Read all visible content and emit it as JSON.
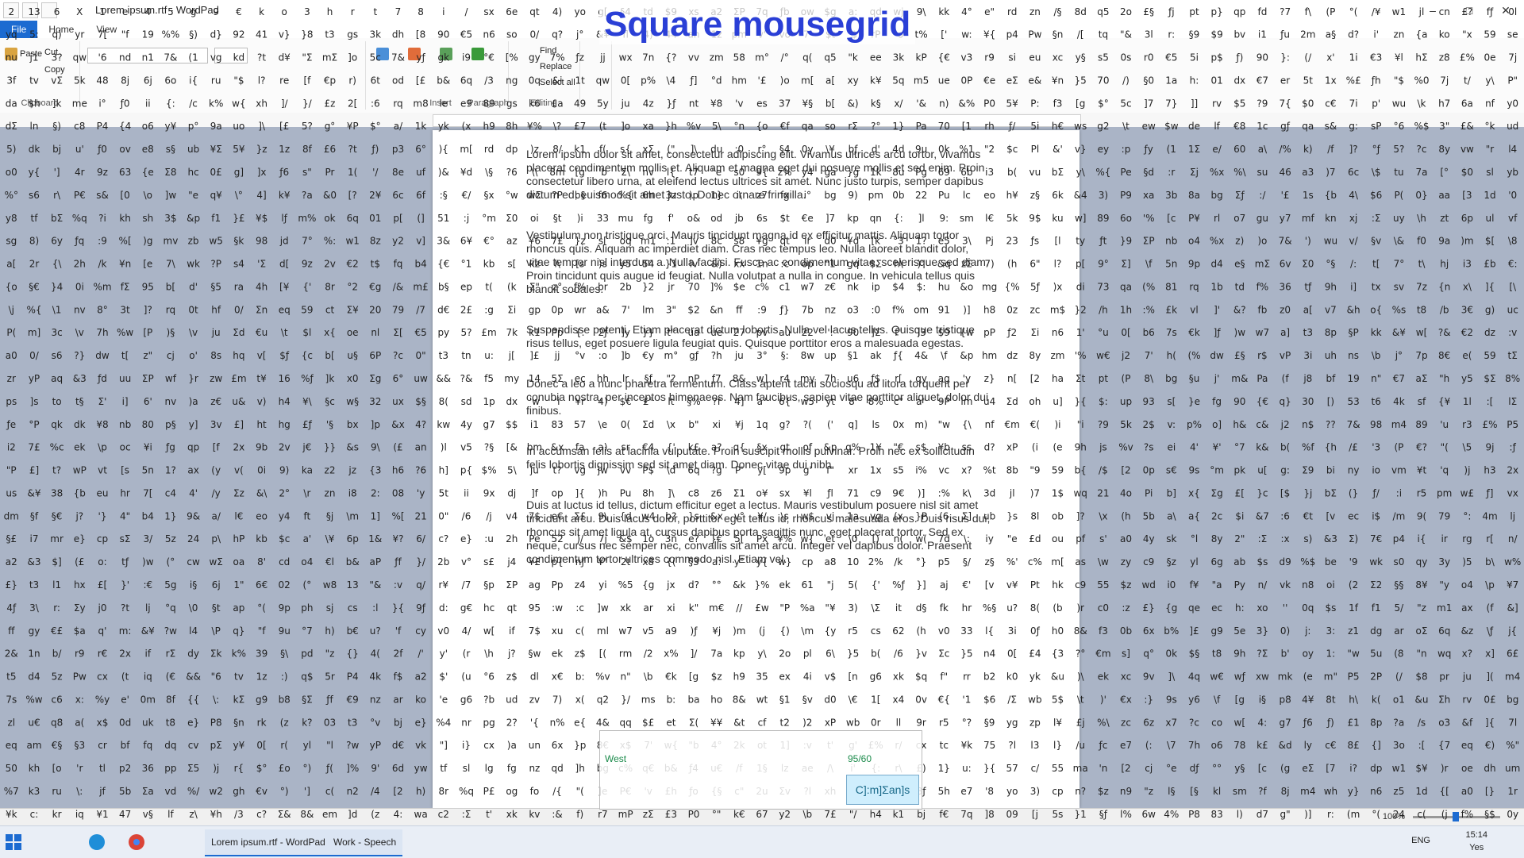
{
  "window": {
    "title": "Lorem ipsum.rtf - WordPad",
    "controls": [
      "–",
      "□",
      "✕"
    ]
  },
  "ribbon": {
    "tabs": [
      "File",
      "Home",
      "View"
    ],
    "clipboard": {
      "label": "Clipboard",
      "cut": "Cut",
      "copy": "Copy",
      "paste": "Paste"
    },
    "paragraph": {
      "label": "Paragraph"
    },
    "insert": {
      "label": "Insert",
      "picture": "Picture",
      "paint": "Paint drawing",
      "datetime": "Date and time",
      "object": "Insert object"
    },
    "editing": {
      "label": "Editing",
      "find": "Find",
      "replace": "Replace",
      "select_all": "Select all"
    }
  },
  "overlay": {
    "title": "Square mousegrid",
    "popup_direction": "West",
    "popup_percent": "95/60",
    "popup_box": "C]:m]Σan]s"
  },
  "document": {
    "paragraphs": [
      "Lorem ipsum dolor sit amet, consectetur adipiscing elit. Vivamus ultrices arcu tortor, vivamus placerat condimentum mollis et. Aliquam et magna eget dui posuere mollis et sed enim. Proin consectetur libero urna, at eleifend lectus ultrices sit amet. Nunc justo turpis, semper dapibus dictum ed, euismod sit amet justo. Donec ornare fringilla.",
      "Vestibulum non tristique orci. Mauris tincidunt magna id ex efficitur mattis. Aliquam tortor rhoncus quis. Aliquam ac imperdiet diam. Cras nec tempus leo. Nulla laoreet blandit dolor, vitae tempor nisl interdum a. Nulla facilisi. Fusce ac condimentum vitae, scelerisque sed diam. Proin tincidunt quis augue id feugiat. Nulla volutpat a nulla in congue. In vehicula tellus quis blandit sodales.",
      "Suspendisse potenti. Etiam placerat dictum lobortis. Nulla vel lacus tellus. Quisque tristique risus tellus, eget posuere ligula feugiat quis. Quisque porttitor eros a malesuada egestas.",
      "Donec a leo a nunc pharetra fermentum. Class aptent taciti sociosqu ad litora torquent per conubia nostra, per inceptos himenaeos. Nam faucibus, sapien vitae porttitor aliquet, dolor dui finibus.",
      "In accumsan felis at lacinia vulputate. Proin suscipit mollis pulvinar. Proin nec ex sollicitudin felis lobortis dignissim sed sit amet diam. Donec vitae dui nibh.",
      "Duis at luctus id tellus, dictum efficitur eget a lectus. Mauris vestibulum posuere nisl sit amet tincidunt arcu. Duis lacus dolor, porttitor eget tellus id, rhoncus malesuada eros. Duis risus dui, rhoncus sit amet ligula at, cursus dapibus porta sagittis nunc, eget placerat tortor. Sed ex neque, cursus nec semper nec, convallis sit amet arcu. Integer vel dapibus dolor. Praesent condimentum tortor ultrices commodo nisl. Etiam vel."
    ]
  },
  "statusbar": {
    "zoom": "100%"
  },
  "taskbar": {
    "apps": [
      "Lorem ipsum.rtf - WordPad",
      "Work - Speech"
    ],
    "language": "ENG",
    "time": "15:14",
    "date": "Yes"
  },
  "grid_labels_row_sample": [
    "2",
    "13",
    "6",
    "X",
    "1",
    "e",
    "4",
    "5",
    "g",
    "9",
    "€",
    "k",
    "o",
    "3",
    "h",
    "r",
    "t",
    "7",
    "8",
    "i",
    "/"
  ]
}
